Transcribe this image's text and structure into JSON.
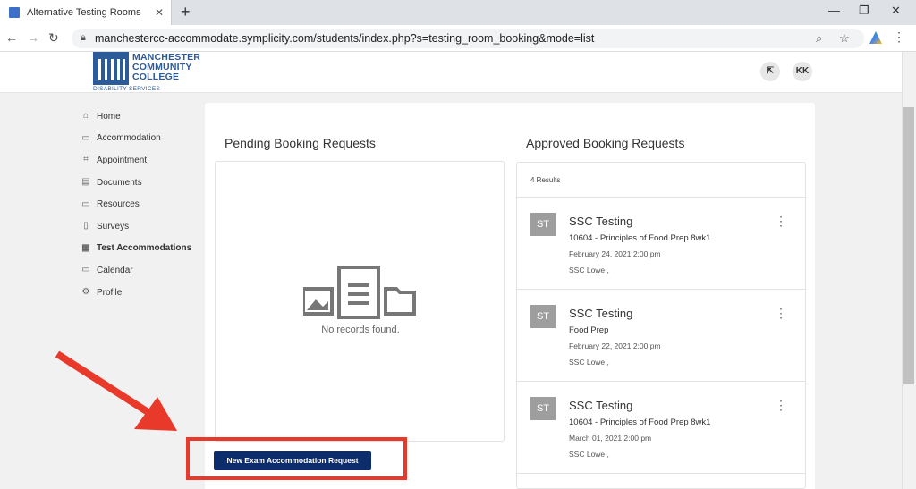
{
  "browser": {
    "tab_title": "Alternative Testing Rooms",
    "tab_close": "✕",
    "new_tab": "+",
    "url": "manchestercc-accommodate.symplicity.com/students/index.php?s=testing_room_booking&mode=list",
    "controls": {
      "minimize": "—",
      "restore": "❐",
      "close": "✕"
    }
  },
  "logo": {
    "line1": "MANCHESTER",
    "line2": "COMMUNITY",
    "line3": "COLLEGE",
    "sub": "DISABILITY SERVICES"
  },
  "header": {
    "user_initials": "KK"
  },
  "sidebar": {
    "items": [
      {
        "label": "Home",
        "icon": "home-icon",
        "glyph": "⌂"
      },
      {
        "label": "Accommodation",
        "icon": "message-icon",
        "glyph": "▭"
      },
      {
        "label": "Appointment",
        "icon": "appointment-icon",
        "glyph": "⌗"
      },
      {
        "label": "Documents",
        "icon": "document-icon",
        "glyph": "▤"
      },
      {
        "label": "Resources",
        "icon": "folder-icon",
        "glyph": "▭"
      },
      {
        "label": "Surveys",
        "icon": "clipboard-icon",
        "glyph": "▯"
      },
      {
        "label": "Test Accommodations",
        "icon": "building-icon",
        "glyph": "▦"
      },
      {
        "label": "Calendar",
        "icon": "calendar-icon",
        "glyph": "▭"
      },
      {
        "label": "Profile",
        "icon": "gear-icon",
        "glyph": "⚙"
      }
    ],
    "active_index": 6
  },
  "pending": {
    "title": "Pending Booking Requests",
    "empty_text": "No records found."
  },
  "approved": {
    "title": "Approved Booking Requests",
    "results": "4 Results",
    "records": [
      {
        "avatar": "ST",
        "title": "SSC Testing",
        "course": "10604 - Principles of Food Prep 8wk1",
        "date": "February 24, 2021 2:00 pm",
        "location": "SSC Lowe ,"
      },
      {
        "avatar": "ST",
        "title": "SSC Testing",
        "course": "Food Prep",
        "date": "February 22, 2021 2:00 pm",
        "location": "SSC Lowe ,"
      },
      {
        "avatar": "ST",
        "title": "SSC Testing",
        "course": "10604 - Principles of Food Prep 8wk1",
        "date": "March 01, 2021 2:00 pm",
        "location": "SSC Lowe ,"
      }
    ]
  },
  "actions": {
    "new_request": "New Exam Accommodation Request"
  },
  "colors": {
    "primary_button": "#0d2c6c",
    "annotation": "#e8392a",
    "brand": "#2c5b9a"
  }
}
